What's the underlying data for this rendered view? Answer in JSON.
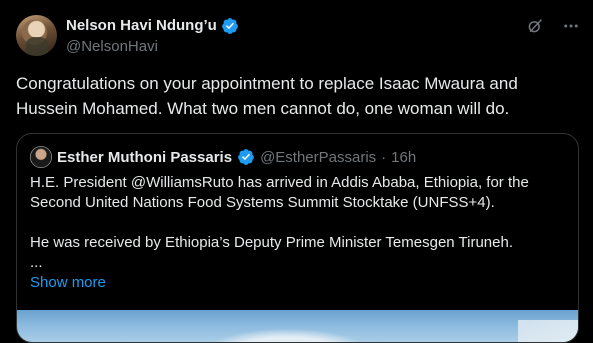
{
  "author": {
    "display_name": "Nelson Havi Ndung’u",
    "handle": "@NelsonHavi"
  },
  "post": {
    "text_line1": "Congratulations on your appointment to replace Isaac Mwaura and",
    "text_line2": "Hussein Mohamed. What two men cannot do, one woman will do."
  },
  "quoted": {
    "display_name": "Esther Muthoni Passaris",
    "handle": "@EstherPassaris",
    "separator": "·",
    "time": "16h",
    "line1": "H.E. President @WilliamsRuto has arrived in Addis Ababa, Ethiopia, for the",
    "line2": "Second United Nations Food Systems Summit Stocktake (UNFSS+4).",
    "line3": "He was received by Ethiopia’s Deputy Prime Minister Temesgen Tiruneh.",
    "ellipsis": "...",
    "show_more": "Show more"
  },
  "icons": {
    "verified": "verified-badge-icon",
    "grok": "grok-icon",
    "more": "more-icon"
  },
  "colors": {
    "background": "#000000",
    "text": "#e7e9ea",
    "muted": "#71767b",
    "accent": "#1d9bf0",
    "border": "#2f3336"
  }
}
